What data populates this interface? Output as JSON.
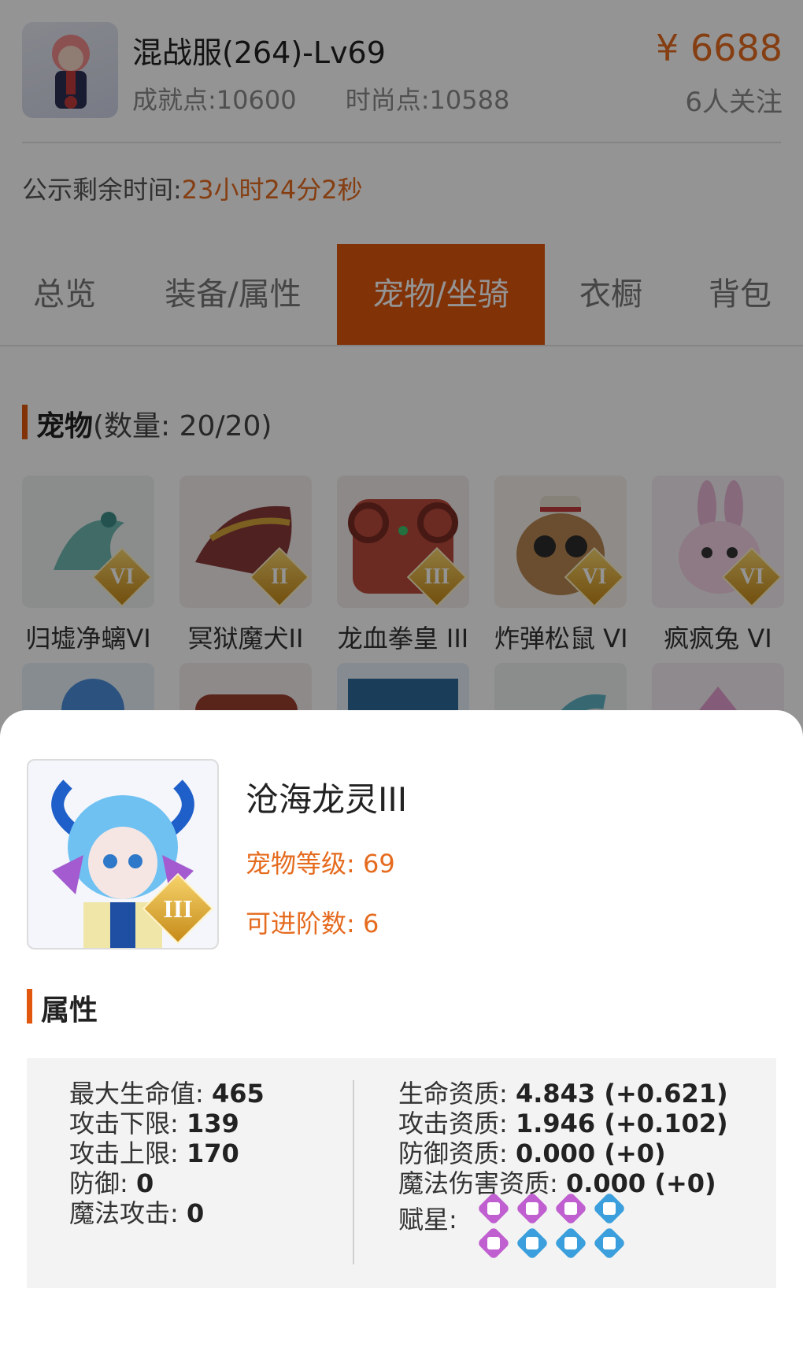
{
  "header": {
    "server": "混战服(264)-Lv69",
    "achievement": "成就点:10600",
    "fashion": "时尚点:10588",
    "price": "¥ 6688",
    "followers": "6人关注"
  },
  "countdown": {
    "label": "公示剩余时间:",
    "value": "23小时24分2秒"
  },
  "tabs": [
    {
      "label": "总览",
      "active": false
    },
    {
      "label": "装备/属性",
      "active": false
    },
    {
      "label": "宠物/坐骑",
      "active": true
    },
    {
      "label": "衣橱",
      "active": false
    },
    {
      "label": "背包",
      "active": false
    }
  ],
  "pets_section": {
    "title": "宠物",
    "count": "(数量: 20/20)"
  },
  "pets": [
    {
      "name": "归墟净螭VI",
      "rank": "VI",
      "color": "#6fb9b1"
    },
    {
      "name": "冥狱魔犬II",
      "rank": "II",
      "color": "#8b3a3a"
    },
    {
      "name": "龙血拳皇 III",
      "rank": "III",
      "color": "#b9493c"
    },
    {
      "name": "炸弹松鼠 VI",
      "rank": "VI",
      "color": "#b88752"
    },
    {
      "name": "疯疯兔 VI",
      "rank": "VI",
      "color": "#e7b7d6"
    }
  ],
  "detail": {
    "name": "沧海龙灵III",
    "rank": "III",
    "level_label": "宠物等级: 69",
    "stage_label": "可进阶数: 6"
  },
  "attributes": {
    "title": "属性",
    "left": [
      {
        "label": "最大生命值: ",
        "value": "465"
      },
      {
        "label": "攻击下限: ",
        "value": "139"
      },
      {
        "label": "攻击上限: ",
        "value": "170"
      },
      {
        "label": "防御: ",
        "value": "0"
      },
      {
        "label": "魔法攻击: ",
        "value": "0"
      }
    ],
    "right": [
      {
        "label": "生命资质: ",
        "value": "4.843 (+0.621)"
      },
      {
        "label": "攻击资质: ",
        "value": "1.946 (+0.102)"
      },
      {
        "label": "防御资质: ",
        "value": "0.000 (+0)"
      },
      {
        "label": "魔法伤害资质: ",
        "value": "0.000 (+0)"
      }
    ],
    "star_label": "赋星:",
    "stars": [
      "purple",
      "purple",
      "purple",
      "blue",
      "purple",
      "blue",
      "blue",
      "blue"
    ]
  }
}
